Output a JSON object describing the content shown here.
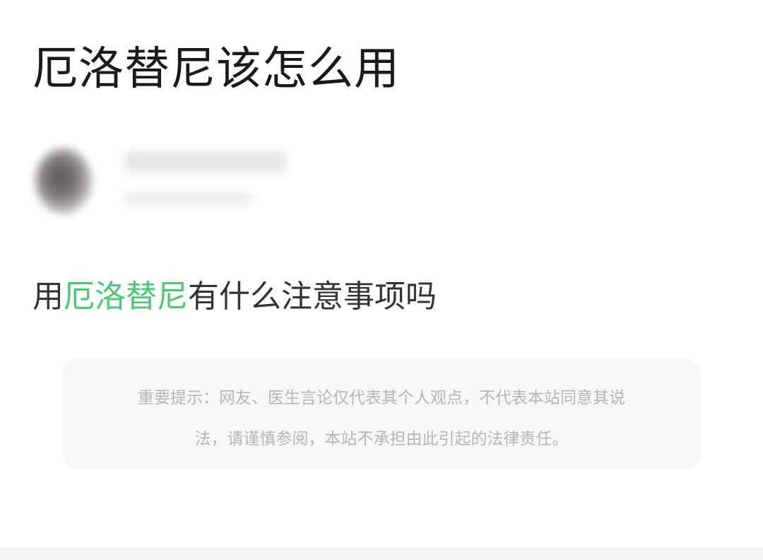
{
  "page": {
    "title": "厄洛替尼该怎么用"
  },
  "author": {
    "name": "",
    "meta": ""
  },
  "question": {
    "prefix": "用",
    "highlight": "厄洛替尼",
    "suffix": "有什么注意事项吗"
  },
  "notice": {
    "line1": "重要提示：网友、医生言论仅代表其个人观点，不代表本站同意其说",
    "line2": "法，请谨慎参阅，本站不承担由此引起的法律责任。"
  },
  "colors": {
    "highlight": "#4cc777",
    "title": "#1a1a1a",
    "notice_text": "#b5b5b5",
    "notice_bg": "#f7f7f7"
  }
}
